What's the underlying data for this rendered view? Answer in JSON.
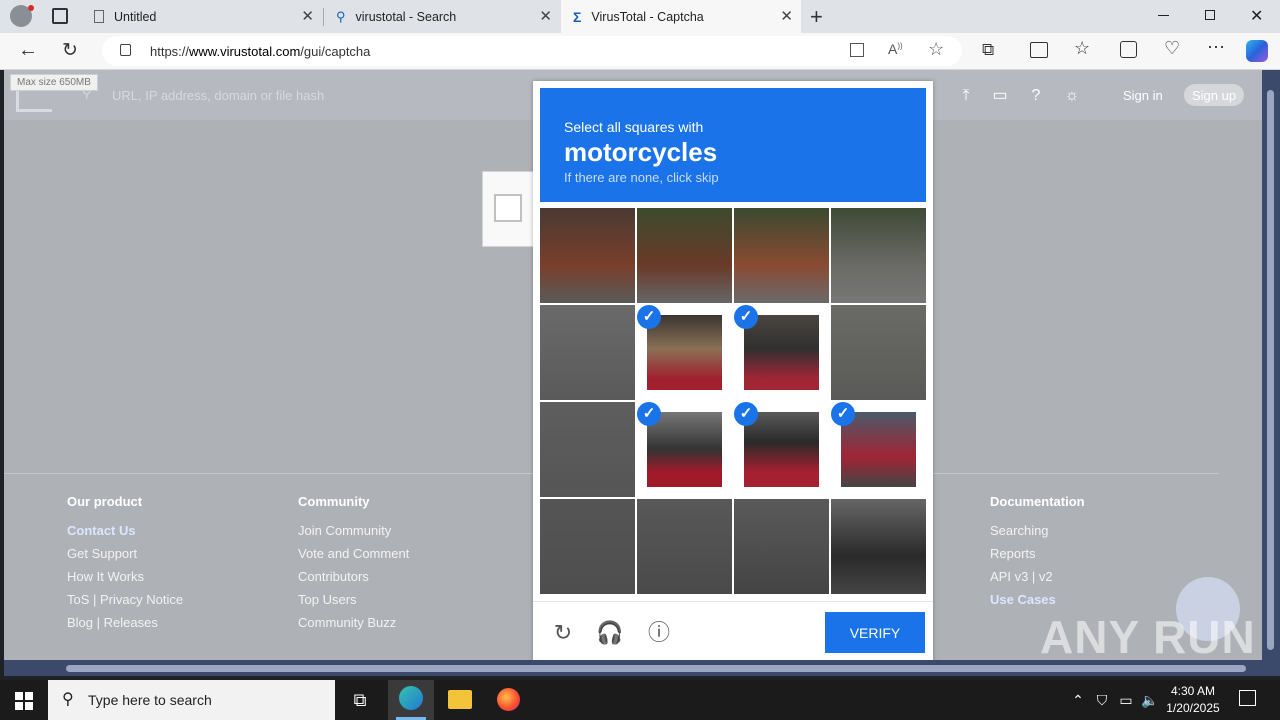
{
  "browser": {
    "tabs": [
      {
        "title": "Untitled"
      },
      {
        "title": "virustotal - Search"
      },
      {
        "title": "VirusTotal - Captcha"
      }
    ],
    "url_prefix": "https://",
    "url_host": "www.virustotal.com",
    "url_path": "/gui/captcha"
  },
  "vt": {
    "search_placeholder": "URL, IP address, domain or file hash",
    "max_size_tooltip": "Max size 650MB",
    "sign_in": "Sign in",
    "sign_up": "Sign up",
    "footer": {
      "col1": {
        "title": "Our product",
        "links": [
          "Contact Us",
          "Get Support",
          "How It Works",
          "ToS | Privacy Notice",
          "Blog | Releases"
        ]
      },
      "col2": {
        "title": "Community",
        "links": [
          "Join Community",
          "Vote and Comment",
          "Contributors",
          "Top Users",
          "Community Buzz"
        ]
      },
      "col3": {
        "title": "Documentation",
        "links": [
          "Searching",
          "Reports",
          "API v3 | v2",
          "Use Cases"
        ]
      }
    }
  },
  "captcha": {
    "line1": "Select all squares with",
    "target": "motorcycles",
    "line3": "If there are none, click skip",
    "verify_label": "VERIFY",
    "selected_cells": [
      5,
      6,
      9,
      10,
      11
    ],
    "accent": "#1a73e8"
  },
  "watermark": "ANY RUN",
  "taskbar": {
    "search_text": "Type here to search",
    "time": "4:30 AM",
    "date": "1/20/2025"
  }
}
